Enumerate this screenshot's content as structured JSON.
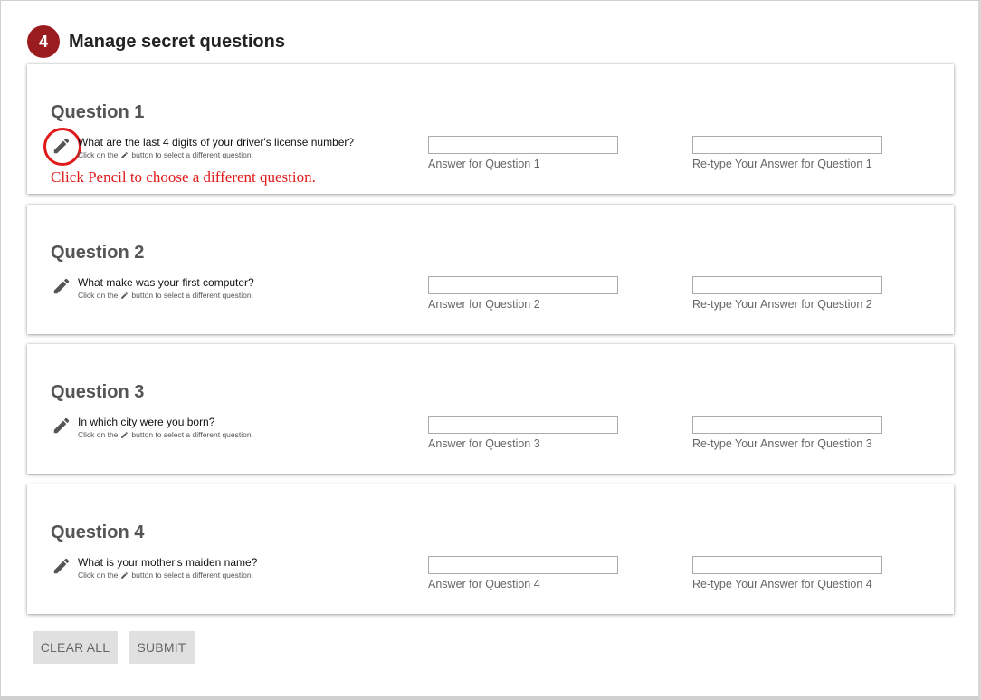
{
  "header": {
    "step_number": "4",
    "title": "Manage secret questions"
  },
  "hint": {
    "prefix": "Click on the",
    "suffix": "button to select a different question.",
    "icon": "pencil-icon"
  },
  "annotation": "Click Pencil to choose a different question.",
  "questions": [
    {
      "title": "Question 1",
      "text": "What are the last 4 digits of your driver's license number?",
      "answer_label": "Answer for Question 1",
      "answer_value": "",
      "retype_label": "Re-type Your Answer for Question 1",
      "retype_value": ""
    },
    {
      "title": "Question 2",
      "text": "What make was your first computer?",
      "answer_label": "Answer for Question 2",
      "answer_value": "",
      "retype_label": "Re-type Your Answer for Question 2",
      "retype_value": ""
    },
    {
      "title": "Question 3",
      "text": "In which city were you born?",
      "answer_label": "Answer for Question 3",
      "answer_value": "",
      "retype_label": "Re-type Your Answer for Question 3",
      "retype_value": ""
    },
    {
      "title": "Question 4",
      "text": "What is your mother's maiden name?",
      "answer_label": "Answer for Question 4",
      "answer_value": "",
      "retype_label": "Re-type Your Answer for Question 4",
      "retype_value": ""
    }
  ],
  "buttons": {
    "clear_all": "CLEAR ALL",
    "submit": "SUBMIT"
  },
  "colors": {
    "badge": "#9b1c1f",
    "annotation": "#e01a1a",
    "button_bg": "#e0e0e0"
  }
}
